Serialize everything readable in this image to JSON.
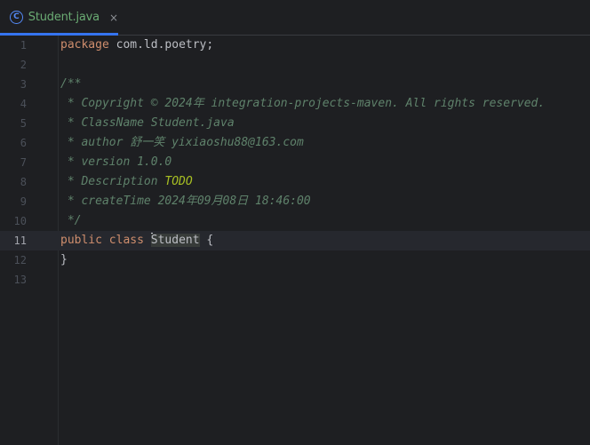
{
  "tab": {
    "icon": "java-class-icon",
    "icon_glyph": "C",
    "label": "Student.java",
    "close": "×",
    "label_color": "#6aab73",
    "accent": "#3574f0"
  },
  "lines": [
    {
      "num": "1",
      "parts": [
        {
          "t": "package",
          "c": "kw"
        },
        {
          "t": " com.ld.poetry;",
          "c": ""
        }
      ]
    },
    {
      "num": "2",
      "parts": []
    },
    {
      "num": "3",
      "parts": [
        {
          "t": "/**",
          "c": "doc"
        }
      ]
    },
    {
      "num": "4",
      "parts": [
        {
          "t": " * Copyright © 2024年 integration-projects-maven. All rights reserved.",
          "c": "doc"
        }
      ]
    },
    {
      "num": "5",
      "parts": [
        {
          "t": " * ClassName Student.java",
          "c": "doc"
        }
      ]
    },
    {
      "num": "6",
      "parts": [
        {
          "t": " * author 舒一笑 yixiaoshu88@163.com",
          "c": "doc"
        }
      ]
    },
    {
      "num": "7",
      "parts": [
        {
          "t": " * version 1.0.0",
          "c": "doc"
        }
      ]
    },
    {
      "num": "8",
      "parts": [
        {
          "t": " * Description ",
          "c": "doc"
        },
        {
          "t": "TODO",
          "c": "todo"
        }
      ]
    },
    {
      "num": "9",
      "parts": [
        {
          "t": " * createTime 2024年09月08日 18:46:00",
          "c": "doc"
        }
      ]
    },
    {
      "num": "10",
      "parts": [
        {
          "t": " */",
          "c": "doc"
        }
      ]
    },
    {
      "num": "11",
      "current": true,
      "parts": [
        {
          "t": "public",
          "c": "kw"
        },
        {
          "t": " ",
          "c": ""
        },
        {
          "t": "class",
          "c": "kw"
        },
        {
          "t": " ",
          "c": ""
        },
        {
          "t": "Student",
          "c": "cls-hl",
          "caret": true
        },
        {
          "t": " {",
          "c": ""
        }
      ]
    },
    {
      "num": "12",
      "parts": [
        {
          "t": "}",
          "c": ""
        }
      ]
    },
    {
      "num": "13",
      "parts": []
    }
  ],
  "colors": {
    "background": "#1e1f22",
    "keyword": "#cf8e6d",
    "doc_comment": "#5f826b",
    "todo": "#a8c023",
    "text": "#bcbec4",
    "line_number": "#4b5059",
    "current_line": "#26282e"
  }
}
